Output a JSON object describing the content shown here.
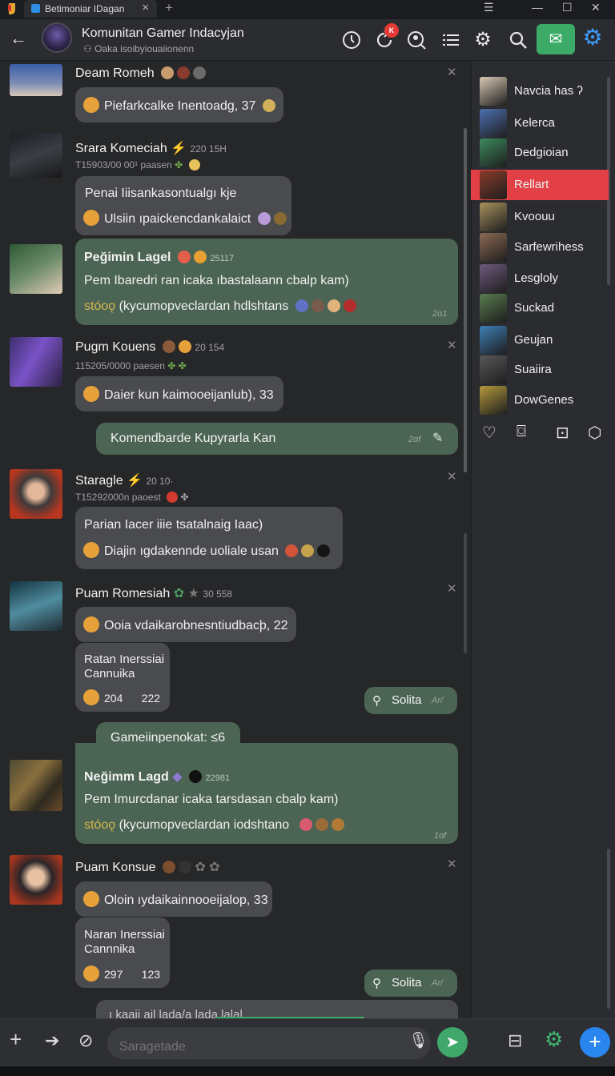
{
  "browser": {
    "tab_title": "Betimoniar IDagan",
    "tab_close": "×",
    "new_tab": "+",
    "window_controls": [
      "☰",
      "—",
      "☐",
      "✕"
    ]
  },
  "header": {
    "title": "Komunitan Gamer Indacyjan",
    "subtitle": "Oaka isoibyiouaiionenn",
    "badge": "K",
    "icons": [
      "history-icon",
      "refresh-icon",
      "search-user-icon",
      "list-icon",
      "gear-icon",
      "search-icon",
      "mail-icon",
      "settings-icon"
    ]
  },
  "messages": [
    {
      "name": "Deam Romeh",
      "lines": [
        "Piefarkcalke Inentoadg, 37"
      ],
      "reactions": [
        "#8b3a2e",
        "#6b6b6b"
      ]
    },
    {
      "name": "Srara Komeciah",
      "time": "220 15H",
      "meta": "T15903/00 00¹ paasen",
      "lines": [
        "Penai Iiisankasontualgı kje",
        "Ulsiin ıpaickencdankalaict"
      ]
    },
    {
      "name": "Peğimin Lagel",
      "time": "25117",
      "lines": [
        "Pem Ibaredri ran icaka ıbastalaann cbalp kam)",
        "stóoǫ",
        "(kycumopveclardan hdlshtans"
      ],
      "timestamp": "2ɑ1"
    },
    {
      "name": "Pugm Kouens",
      "time": "20 154",
      "meta": "115205/0000 paesen",
      "lines": [
        "Daier kun kaimooeijanlub), 33"
      ]
    },
    {
      "outgoing": "Komendbarde Kupyrarla Kan",
      "timestamp": "2ɑf"
    },
    {
      "name": "Staragle",
      "time": "20 10·",
      "meta": "T15292000n paoest",
      "lines": [
        "Parian Iacer iiie tsatalnaig Iaac)",
        "Diajin ıgdakennde uoliale usan"
      ]
    },
    {
      "name": "Puam Romesiah",
      "time": "30 558",
      "lines": [
        "Ooia vdaikarobnesntiudbacþ, 22"
      ],
      "card": {
        "line1": "Ratan Inerssiai",
        "line2": "Cannuika",
        "count1": "204",
        "count2": "222"
      },
      "pill": "Solita",
      "pill_time": "Ar/"
    },
    {
      "outgoing": "Gameiinpenokat: ≤6"
    },
    {
      "name": "Neğimm Lagd",
      "time": "22981",
      "lines": [
        "Pem Imurcdanar icaka tarsdasan cbalp kam)",
        "stóoǫ",
        "(kycumopveclardan iodshtano"
      ],
      "timestamp": "1ɑf"
    },
    {
      "name": "Puam Konsue",
      "lines": [
        "Oloin ıydaikainnooeijalop, 33"
      ],
      "card": {
        "line1": "Naran Inerssiai",
        "line2": "Cannnika",
        "count1": "297",
        "count2": "123"
      },
      "pill": "Solita",
      "pill_time": "Ar/"
    },
    {
      "outgoing": "ı kaaii ail lada/a lada lalal"
    }
  ],
  "sidebar": {
    "items": [
      {
        "label": "Navcia has ʔ",
        "color": "#d9c9b5"
      },
      {
        "label": "Kelerca",
        "color": "#4d6fb1"
      },
      {
        "label": "Dedgioian",
        "color": "#3c8a5d"
      },
      {
        "label": "Rellart",
        "color": "#8a3b2a",
        "active": true
      },
      {
        "label": "Kvoouu",
        "color": "#a8915d"
      },
      {
        "label": "Sarfewrihess",
        "color": "#8d6a54"
      },
      {
        "label": "Lesgloly",
        "color": "#6f5a7e"
      },
      {
        "label": "Suckad",
        "color": "#5a7d4f"
      },
      {
        "label": "Geujan",
        "color": "#3d7fb6"
      },
      {
        "label": "Suaiira",
        "color": "#585858"
      },
      {
        "label": "DowGenes",
        "color": "#b59a3c"
      }
    ],
    "actions": [
      "heart-icon",
      "camera-icon",
      "bot-icon",
      "box-icon"
    ]
  },
  "composer": {
    "placeholder": "Saragetade"
  },
  "colors": {
    "accent_green": "#3fa86a",
    "accent_blue": "#2a86ef",
    "active_red": "#e24046",
    "bubble_green": "#4b6454"
  }
}
